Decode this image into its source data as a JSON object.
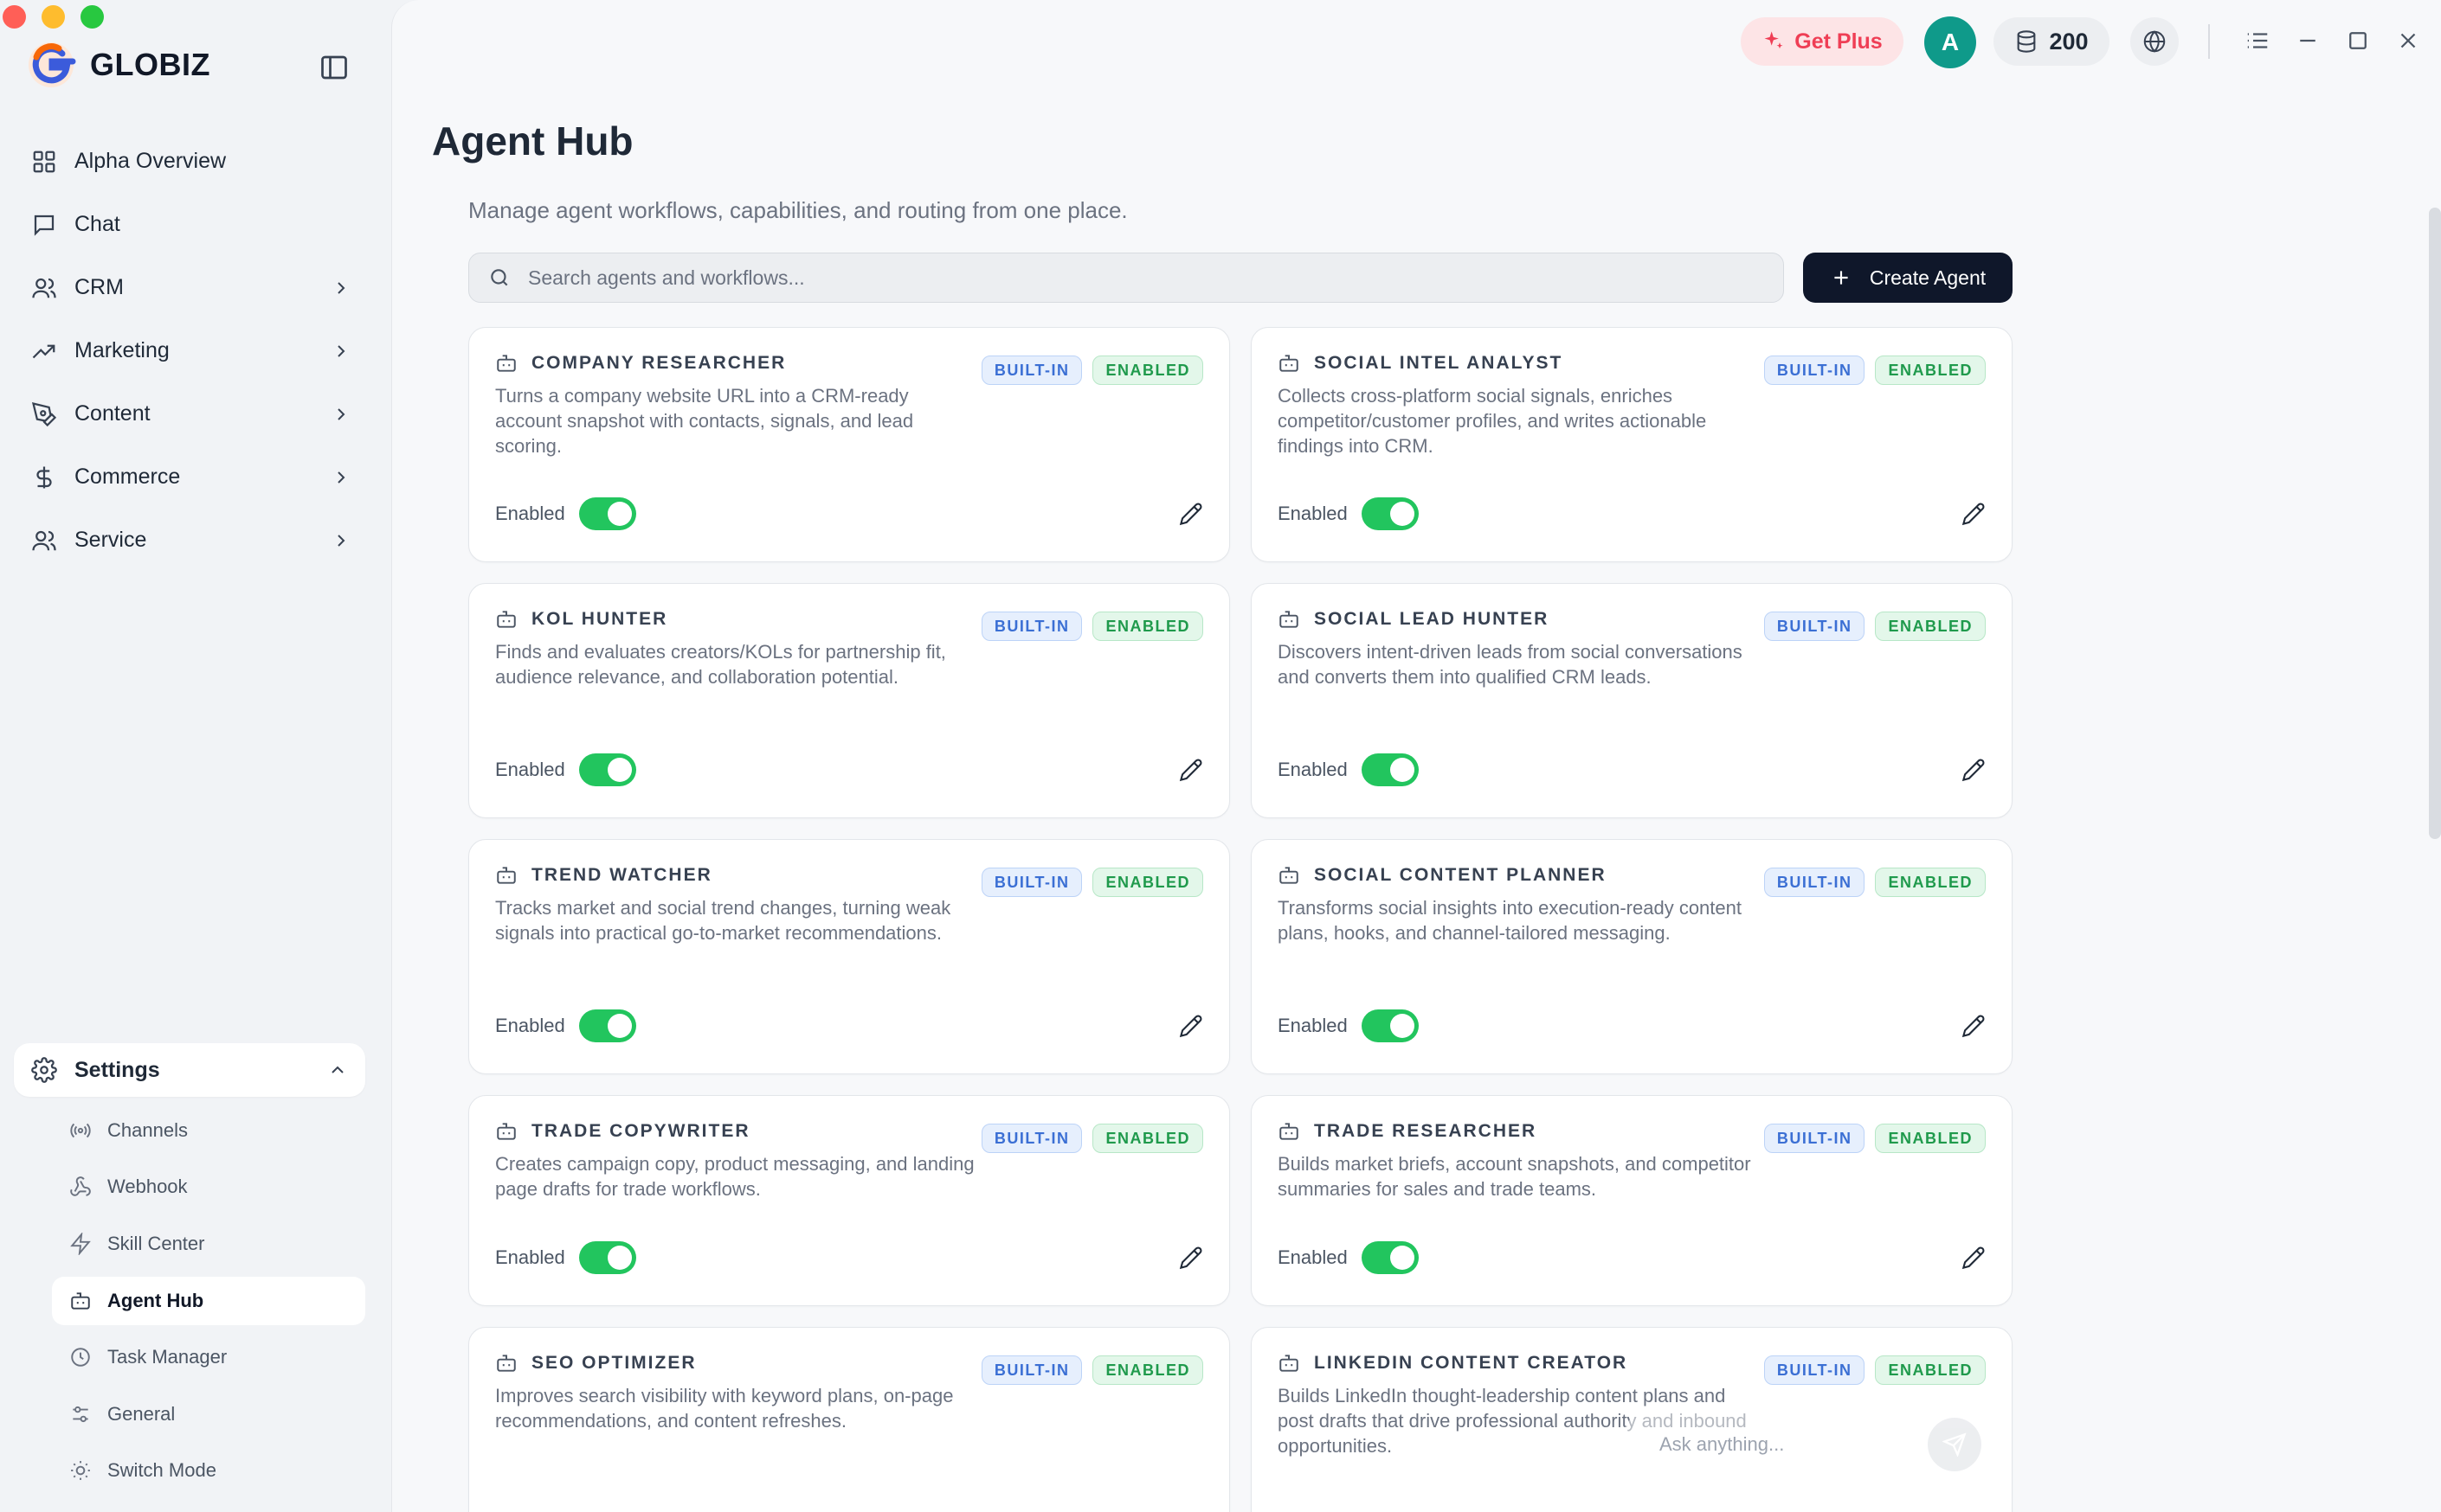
{
  "app": {
    "name": "GLOBIZ"
  },
  "colors": {
    "accent": "#22c55e",
    "primary_button": "#0f172a",
    "plus_text": "#ef3e55",
    "avatar_bg": "#0f9a8a"
  },
  "sidebar": {
    "items": [
      {
        "label": "Alpha Overview",
        "icon": "grid-icon",
        "expandable": false
      },
      {
        "label": "Chat",
        "icon": "chat-icon",
        "expandable": false
      },
      {
        "label": "CRM",
        "icon": "users-icon",
        "expandable": true
      },
      {
        "label": "Marketing",
        "icon": "trending-up-icon",
        "expandable": true
      },
      {
        "label": "Content",
        "icon": "pen-tool-icon",
        "expandable": true
      },
      {
        "label": "Commerce",
        "icon": "dollar-icon",
        "expandable": true
      },
      {
        "label": "Service",
        "icon": "users-icon",
        "expandable": true
      }
    ],
    "settings": {
      "label": "Settings",
      "sub_items": [
        {
          "label": "Channels",
          "icon": "radio-icon"
        },
        {
          "label": "Webhook",
          "icon": "webhook-icon"
        },
        {
          "label": "Skill Center",
          "icon": "lightning-icon"
        },
        {
          "label": "Agent Hub",
          "icon": "bot-icon",
          "active": true
        },
        {
          "label": "Task Manager",
          "icon": "clock-icon"
        },
        {
          "label": "General",
          "icon": "sliders-icon"
        },
        {
          "label": "Switch Mode",
          "icon": "sun-icon"
        }
      ]
    }
  },
  "topbar": {
    "get_plus": "Get Plus",
    "avatar_initial": "A",
    "credits": "200"
  },
  "main": {
    "title": "Agent Hub",
    "subtitle": "Manage agent workflows, capabilities, and routing from one place.",
    "search_placeholder": "Search agents and workflows...",
    "create_button": "Create Agent",
    "badge_builtin": "BUILT-IN",
    "badge_enabled": "ENABLED",
    "enabled_label": "Enabled",
    "agents": [
      {
        "name": "COMPANY RESEARCHER",
        "description": "Turns a company website URL into a CRM-ready account snapshot with contacts, signals, and lead scoring.",
        "enabled": true
      },
      {
        "name": "SOCIAL INTEL ANALYST",
        "description": "Collects cross-platform social signals, enriches competitor/customer profiles, and writes actionable findings into CRM.",
        "enabled": true
      },
      {
        "name": "KOL HUNTER",
        "description": "Finds and evaluates creators/KOLs for partnership fit, audience relevance, and collaboration potential.",
        "enabled": true
      },
      {
        "name": "SOCIAL LEAD HUNTER",
        "description": "Discovers intent-driven leads from social conversations and converts them into qualified CRM leads.",
        "enabled": true
      },
      {
        "name": "TREND WATCHER",
        "description": "Tracks market and social trend changes, turning weak signals into practical go-to-market recommendations.",
        "enabled": true
      },
      {
        "name": "SOCIAL CONTENT PLANNER",
        "description": "Transforms social insights into execution-ready content plans, hooks, and channel-tailored messaging.",
        "enabled": true
      },
      {
        "name": "TRADE COPYWRITER",
        "description": "Creates campaign copy, product messaging, and landing page drafts for trade workflows.",
        "enabled": true
      },
      {
        "name": "TRADE RESEARCHER",
        "description": "Builds market briefs, account snapshots, and competitor summaries for sales and trade teams.",
        "enabled": true
      },
      {
        "name": "SEO OPTIMIZER",
        "description": "Improves search visibility with keyword plans, on-page recommendations, and content refreshes.",
        "enabled": true
      },
      {
        "name": "LINKEDIN CONTENT CREATOR",
        "description": "Builds LinkedIn thought-leadership content plans and post drafts that drive professional authority and inbound opportunities.",
        "enabled": true
      }
    ],
    "composer_placeholder": "Ask anything..."
  }
}
